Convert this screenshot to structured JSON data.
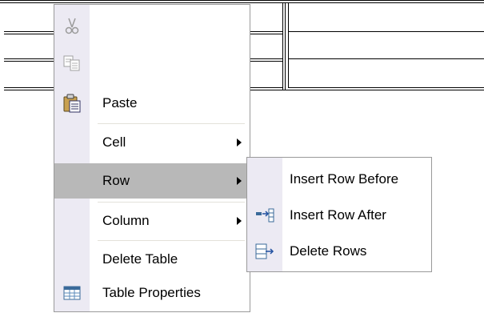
{
  "context_menu": {
    "items": [
      {
        "label": "",
        "icon": "cut-icon",
        "enabled": false
      },
      {
        "label": "",
        "icon": "copy-icon",
        "enabled": false
      },
      {
        "label": "Paste",
        "icon": "paste-icon",
        "enabled": true
      },
      {
        "label": "Cell",
        "has_submenu": true
      },
      {
        "label": "Row",
        "has_submenu": true,
        "selected": true
      },
      {
        "label": "Column",
        "has_submenu": true
      },
      {
        "label": "Delete Table"
      },
      {
        "label": "Table Properties",
        "icon": "table-properties-icon"
      }
    ]
  },
  "row_submenu": {
    "items": [
      {
        "label": "Insert Row Before"
      },
      {
        "label": "Insert Row After",
        "icon": "insert-row-after-icon"
      },
      {
        "label": "Delete Rows",
        "icon": "delete-rows-icon"
      }
    ]
  }
}
